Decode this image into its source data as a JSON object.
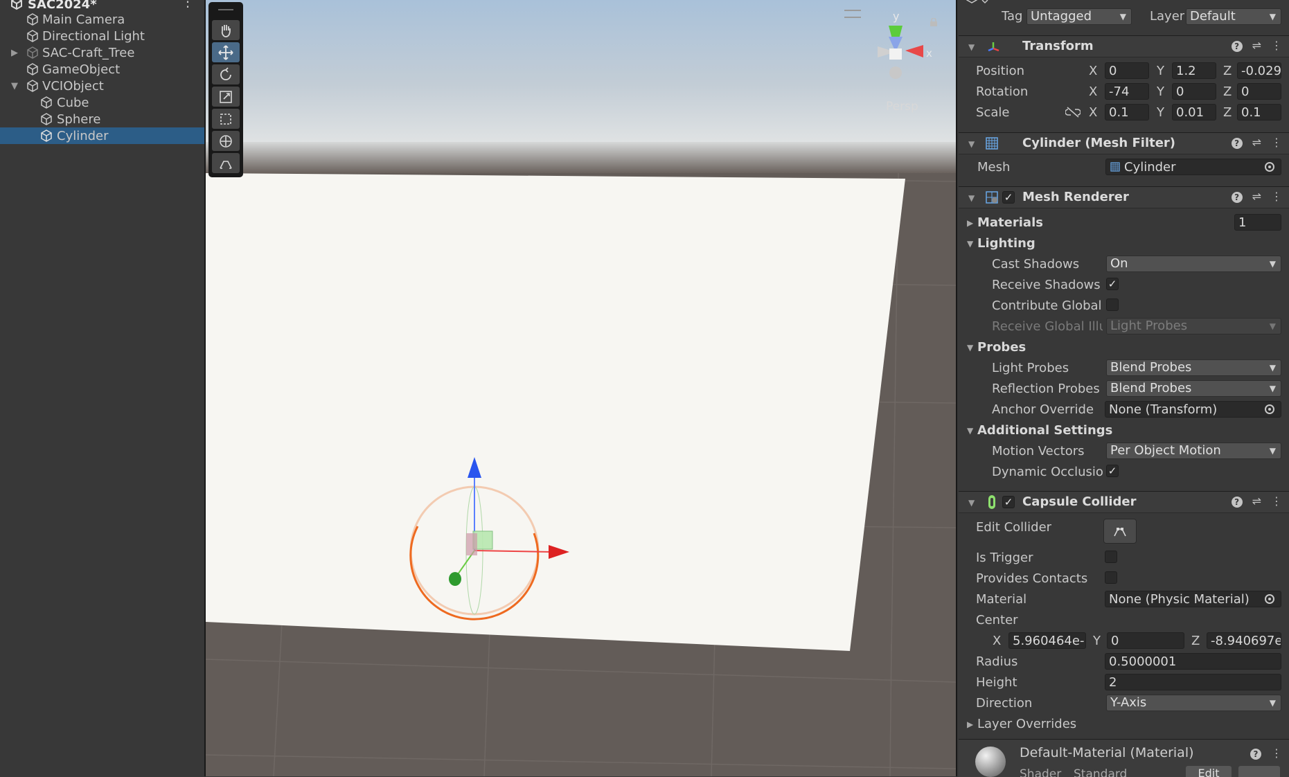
{
  "hierarchy": {
    "scene_name": "SAC2024*",
    "items": [
      {
        "label": "Main Camera"
      },
      {
        "label": "Directional Light"
      },
      {
        "label": "SAC-Craft_Tree"
      },
      {
        "label": "GameObject"
      },
      {
        "label": "VCIObject"
      },
      {
        "label": "Cube"
      },
      {
        "label": "Sphere"
      },
      {
        "label": "Cylinder"
      }
    ]
  },
  "scene_view": {
    "projection_label": "Persp",
    "gizmo_y": "y",
    "gizmo_x": "x",
    "tools": [
      "hand-tool",
      "move-tool",
      "rotate-tool",
      "scale-tool",
      "rect-tool",
      "transform-tool",
      "custom-tool"
    ]
  },
  "inspector": {
    "tag_label": "Tag",
    "tag_value": "Untagged",
    "layer_label": "Layer",
    "layer_value": "Default",
    "transform": {
      "title": "Transform",
      "position_label": "Position",
      "rotation_label": "Rotation",
      "scale_label": "Scale",
      "axis_x": "X",
      "axis_y": "Y",
      "axis_z": "Z",
      "position": {
        "x": "0",
        "y": "1.2",
        "z": "-0.029"
      },
      "rotation": {
        "x": "-74",
        "y": "0",
        "z": "0"
      },
      "scale": {
        "x": "0.1",
        "y": "0.01",
        "z": "0.1"
      }
    },
    "mesh_filter": {
      "title": "Cylinder (Mesh Filter)",
      "mesh_label": "Mesh",
      "mesh_value": "Cylinder"
    },
    "mesh_renderer": {
      "title": "Mesh Renderer",
      "materials_label": "Materials",
      "materials_count": "1",
      "lighting_label": "Lighting",
      "cast_shadows_label": "Cast Shadows",
      "cast_shadows_value": "On",
      "receive_shadows_label": "Receive Shadows",
      "contribute_global_label": "Contribute Global",
      "receive_global_label": "Receive Global Illu",
      "receive_global_value": "Light Probes",
      "probes_label": "Probes",
      "light_probes_label": "Light Probes",
      "light_probes_value": "Blend Probes",
      "reflection_probes_label": "Reflection Probes",
      "reflection_probes_value": "Blend Probes",
      "anchor_override_label": "Anchor Override",
      "anchor_override_value": "None (Transform)",
      "additional_label": "Additional Settings",
      "motion_vectors_label": "Motion Vectors",
      "motion_vectors_value": "Per Object Motion",
      "dynamic_occlusion_label": "Dynamic Occlusio"
    },
    "capsule_collider": {
      "title": "Capsule Collider",
      "edit_collider_label": "Edit Collider",
      "is_trigger_label": "Is Trigger",
      "provides_contacts_label": "Provides Contacts",
      "material_label": "Material",
      "material_value": "None (Physic Material)",
      "center_label": "Center",
      "center": {
        "x": "5.960464e-",
        "y": "0",
        "z": "-8.940697e"
      },
      "radius_label": "Radius",
      "radius_value": "0.5000001",
      "height_label": "Height",
      "height_value": "2",
      "direction_label": "Direction",
      "direction_value": "Y-Axis",
      "layer_overrides_label": "Layer Overrides"
    },
    "material": {
      "title": "Default-Material (Material)",
      "shader_label": "Shader",
      "shader_value": "Standard",
      "edit_label": "Edit"
    }
  },
  "colors": {
    "selection": "#2c5d87",
    "panel": "#383838",
    "ground": "#635c58",
    "plane": "#f7f6f2"
  }
}
